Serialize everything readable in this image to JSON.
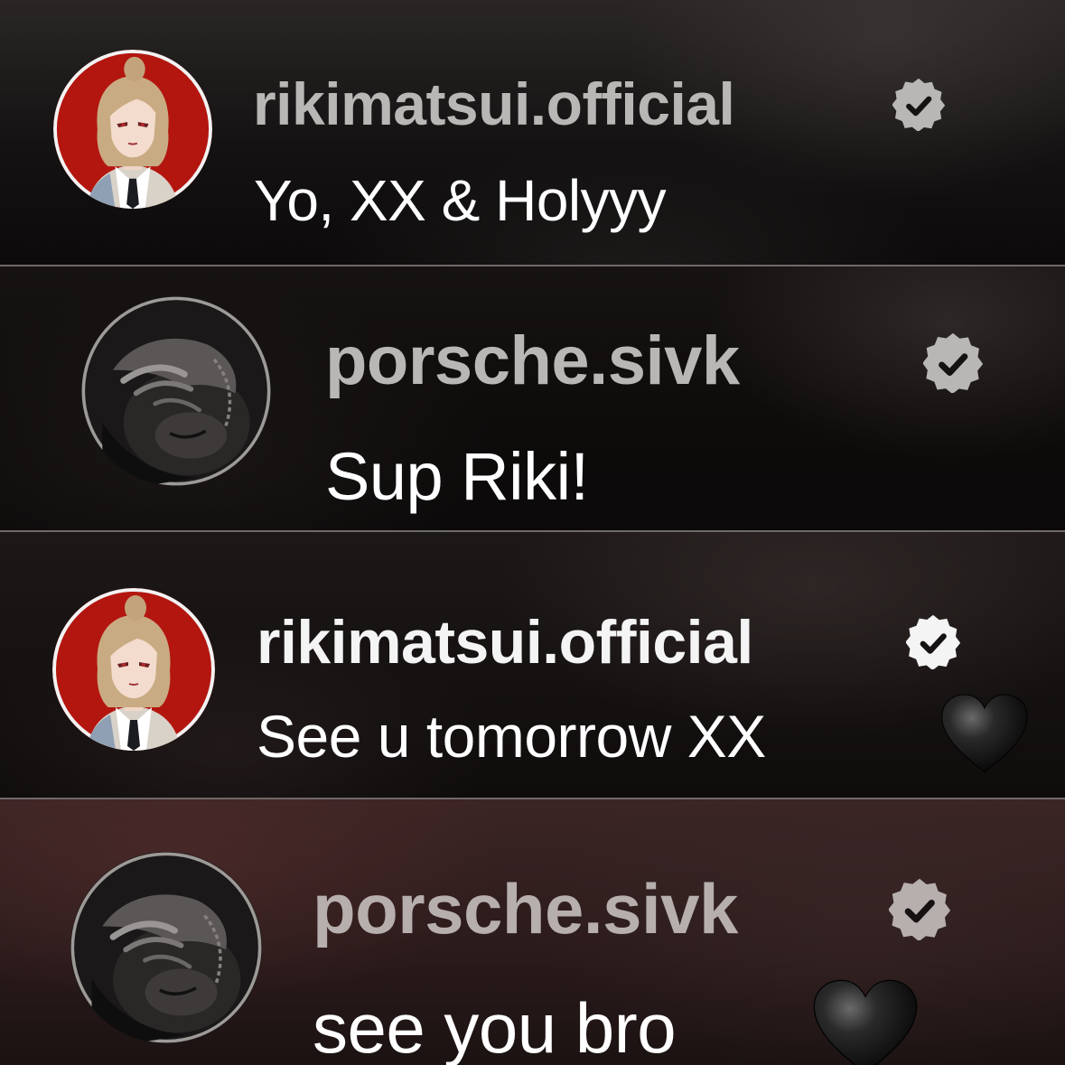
{
  "comments": [
    {
      "username": "rikimatsui.official",
      "text": "Yo, XX & Holyyy",
      "avatar_icon": "illustrated-avatar-red-background",
      "verified_icon": "verified-badge-icon"
    },
    {
      "username": "porsche.sivk",
      "text": "Sup Riki!",
      "avatar_icon": "monochrome-photo-avatar",
      "verified_icon": "verified-badge-icon"
    },
    {
      "username": "rikimatsui.official",
      "text": "See u tomorrow XX",
      "emoji": "black-heart",
      "avatar_icon": "illustrated-avatar-red-background",
      "verified_icon": "verified-badge-icon"
    },
    {
      "username": "porsche.sivk",
      "text": "see you bro",
      "emoji": "black-heart",
      "avatar_icon": "monochrome-photo-avatar",
      "verified_icon": "verified-badge-icon"
    }
  ],
  "colors": {
    "username_dim": "#b9b7b6",
    "username_bright": "#f4f4f4",
    "message_text": "#ffffff",
    "avatar_red": "#b3160f",
    "divider": "#6f6a68"
  }
}
